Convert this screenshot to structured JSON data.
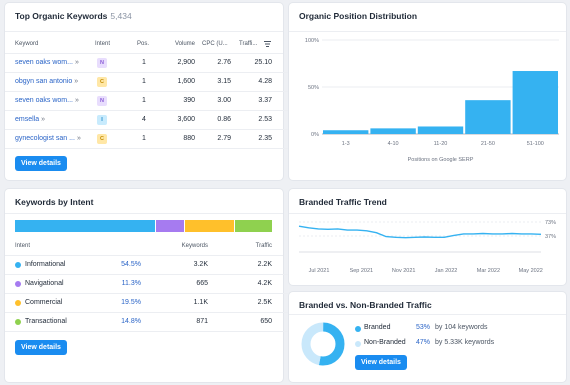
{
  "keywords_card": {
    "title": "Top Organic Keywords",
    "count": "5,434",
    "headers": {
      "keyword": "Keyword",
      "intent": "Intent",
      "pos": "Pos.",
      "volume": "Volume",
      "cpc": "CPC (U...",
      "traffic": "Traffi..."
    },
    "rows": [
      {
        "keyword": "seven oaks wom...",
        "intent": "N",
        "pos": "1",
        "volume": "2,900",
        "cpc": "2.76",
        "traffic": "25.10"
      },
      {
        "keyword": "obgyn san antonio",
        "intent": "C",
        "pos": "1",
        "volume": "1,600",
        "cpc": "3.15",
        "traffic": "4.28"
      },
      {
        "keyword": "seven oaks wom...",
        "intent": "N",
        "pos": "1",
        "volume": "390",
        "cpc": "3.00",
        "traffic": "3.37"
      },
      {
        "keyword": "emsella",
        "intent": "I",
        "pos": "4",
        "volume": "3,600",
        "cpc": "0.86",
        "traffic": "2.53"
      },
      {
        "keyword": "gynecologist san ...",
        "intent": "C",
        "pos": "1",
        "volume": "880",
        "cpc": "2.79",
        "traffic": "2.35"
      }
    ],
    "button": "View details"
  },
  "intent_card": {
    "title": "Keywords by Intent",
    "headers": {
      "intent": "Intent",
      "keywords": "Keywords",
      "traffic": "Traffic"
    },
    "rows": [
      {
        "name": "Informational",
        "pct": "54.5%",
        "share": 54.5,
        "keywords": "3.2K",
        "traffic": "2.2K",
        "color": "#35b2f1"
      },
      {
        "name": "Navigational",
        "pct": "11.3%",
        "share": 11.3,
        "keywords": "665",
        "traffic": "4.2K",
        "color": "#a67bf0"
      },
      {
        "name": "Commercial",
        "pct": "19.5%",
        "share": 19.5,
        "keywords": "1.1K",
        "traffic": "2.5K",
        "color": "#ffc02b"
      },
      {
        "name": "Transactional",
        "pct": "14.8%",
        "share": 14.8,
        "keywords": "871",
        "traffic": "650",
        "color": "#8fd14f"
      }
    ],
    "button": "View details"
  },
  "position_card": {
    "title": "Organic Position Distribution",
    "xlabel": "Positions on Google SERP"
  },
  "trend_card": {
    "title": "Branded Traffic Trend"
  },
  "branded_card": {
    "title": "Branded vs. Non-Branded Traffic",
    "rows": [
      {
        "label": "Branded",
        "pct": "53%",
        "desc": "by 104 keywords",
        "color": "#35b2f1"
      },
      {
        "label": "Non-Branded",
        "pct": "47%",
        "desc": "by 5.33K keywords",
        "color": "#c9e8fb"
      }
    ],
    "branded_share": 53,
    "button": "View details"
  },
  "colors": {
    "accent": "#1a8cf0",
    "bar": "#35b2f1",
    "link": "#2a64c7"
  },
  "chart_data": [
    {
      "type": "bar",
      "title": "Organic Position Distribution",
      "xlabel": "Positions on Google SERP",
      "categories": [
        "1-3",
        "4-10",
        "11-20",
        "21-50",
        "51-100"
      ],
      "values": [
        4,
        6,
        8,
        36,
        67
      ],
      "ylim": [
        0,
        100
      ],
      "yticks": [
        "0%",
        "50%",
        "100%"
      ],
      "grid": true
    },
    {
      "type": "line",
      "title": "Branded Traffic Trend",
      "x": [
        "Jul 2021",
        "Sep 2021",
        "Nov 2021",
        "Jan 2022",
        "Mar 2022",
        "May 2022"
      ],
      "y": [
        62,
        58,
        55,
        54,
        55,
        52,
        52,
        50,
        45,
        35,
        33,
        32,
        33,
        34,
        33,
        33,
        38,
        42,
        42,
        43,
        42,
        42,
        43,
        42,
        42,
        41
      ],
      "ylim": [
        0,
        73
      ],
      "yticks": [
        "73%",
        "37%",
        "0%"
      ],
      "grid": true
    },
    {
      "type": "pie",
      "title": "Branded vs. Non-Branded Traffic",
      "categories": [
        "Branded",
        "Non-Branded"
      ],
      "values": [
        53,
        47
      ]
    }
  ]
}
